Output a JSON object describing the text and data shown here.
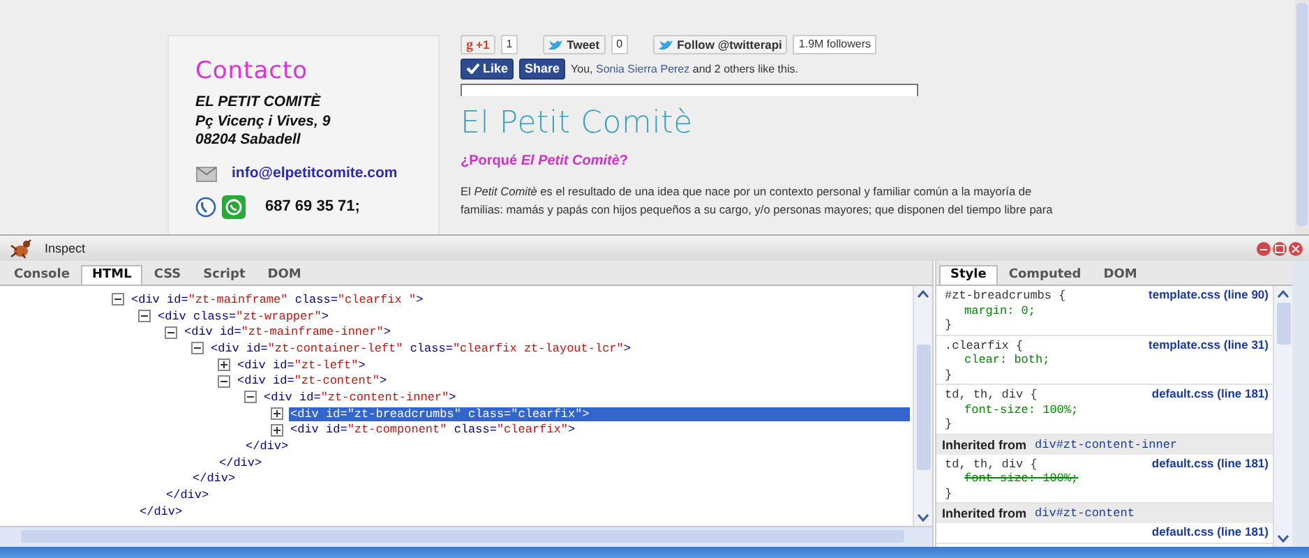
{
  "page": {
    "contact": {
      "title": "Contacto",
      "address": [
        "EL PETIT COMITÈ",
        "Pç Vicenç i Vives, 9",
        "08204 Sabadell"
      ],
      "email": "info@elpetitcomite.com",
      "phone": "687 69 35 71;"
    },
    "social": {
      "gplus_logo": "g",
      "gplus": "+1",
      "gplus_count": "1",
      "tweet": "Tweet",
      "tweet_count": "0",
      "follow": "Follow @twitterapi",
      "followers": "1.9M followers",
      "like": "Like",
      "share": "Share",
      "likes_text_before": "You, ",
      "likes_link": "Sonia Sierra Perez",
      "likes_text_after": " and 2 others like this."
    },
    "title": "El Petit Comitè",
    "subtitle": "¿Porqué *El Petit Comitè*?",
    "paragraph_lines": [
      "El *Petit Comitè* es el resultado de una idea que nace por un contexto personal y familiar  común a la mayoría de",
      "familias: mamás y papás  con hijos pequeños a su cargo,  y/o personas mayores; que disponen del tiempo libre para"
    ]
  },
  "inspector": {
    "title": "Inspect",
    "tabs": [
      {
        "label": "Console",
        "selected": false
      },
      {
        "label": "HTML",
        "selected": true
      },
      {
        "label": "CSS",
        "selected": false
      },
      {
        "label": "Script",
        "selected": false
      },
      {
        "label": "DOM",
        "selected": false
      }
    ],
    "tree": [
      {
        "open": "<div id=\"zt-mainframe\" class=\"clearfix \">",
        "expanded": true,
        "selected": false,
        "children": [
          {
            "open": "<div class=\"zt-wrapper\">",
            "expanded": true,
            "selected": false,
            "close": "</div>",
            "children": [
              {
                "open": "<div id=\"zt-mainframe-inner\">",
                "expanded": true,
                "selected": false,
                "close": "</div>",
                "children": [
                  {
                    "open": "<div id=\"zt-container-left\" class=\"clearfix zt-layout-lcr\">",
                    "expanded": true,
                    "selected": false,
                    "close": "</div>",
                    "children": [
                      {
                        "open": "<div id=\"zt-left\">",
                        "expanded": false,
                        "selected": false
                      },
                      {
                        "open": "<div id=\"zt-content\">",
                        "expanded": true,
                        "selected": false,
                        "close": "</div>",
                        "children": [
                          {
                            "open": "<div id=\"zt-content-inner\">",
                            "expanded": true,
                            "selected": false,
                            "close": "</div>",
                            "children": [
                              {
                                "open": "<div id=\"zt-breadcrumbs\" class=\"clearfix\">",
                                "expanded": false,
                                "selected": true
                              },
                              {
                                "open": "<div id=\"zt-component\" class=\"clearfix\">",
                                "expanded": false,
                                "selected": false
                              }
                            ]
                          }
                        ]
                      }
                    ]
                  }
                ]
              }
            ]
          }
        ]
      }
    ],
    "side_tabs": [
      {
        "label": "Style",
        "selected": true
      },
      {
        "label": "Computed",
        "selected": false
      },
      {
        "label": "DOM",
        "selected": false
      }
    ],
    "style_blocks": [
      {
        "kind": "rule",
        "selector": "#zt-breadcrumbs {",
        "source": "template.css (line 90)",
        "props": [
          {
            "text": "margin: 0;",
            "overridden": false
          }
        ],
        "close": "}"
      },
      {
        "kind": "rule",
        "selector": ".clearfix {",
        "source": "template.css (line 31)",
        "props": [
          {
            "text": "clear: both;",
            "overridden": false
          }
        ],
        "close": "}"
      },
      {
        "kind": "rule",
        "selector": "td, th, div {",
        "source": "default.css (line 181)",
        "props": [
          {
            "text": "font-size: 100%;",
            "overridden": false
          }
        ],
        "close": "}"
      },
      {
        "kind": "inherited",
        "label": "Inherited from",
        "element": "div#zt-content-inner"
      },
      {
        "kind": "rule",
        "selector": "td, th, div {",
        "source": "default.css (line 181)",
        "props": [
          {
            "text": "font-size: 100%;",
            "overridden": true
          }
        ],
        "close": "}"
      },
      {
        "kind": "inherited",
        "label": "Inherited from",
        "element": "div#zt-content"
      },
      {
        "kind": "rule",
        "source": "default.css (line 181)"
      }
    ]
  }
}
